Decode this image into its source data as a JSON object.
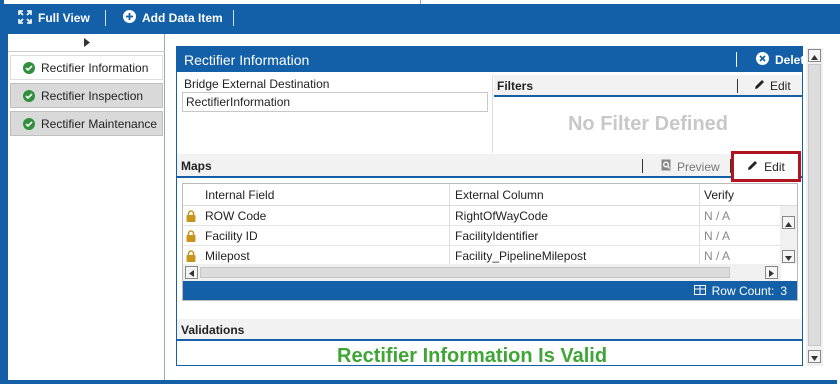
{
  "toolbar": {
    "full_view_label": "Full View",
    "add_data_item_label": "Add Data Item"
  },
  "nav": {
    "items": [
      {
        "label": "Rectifier Information",
        "active": true
      },
      {
        "label": "Rectifier Inspection",
        "active": false
      },
      {
        "label": "Rectifier Maintenance",
        "active": false
      }
    ]
  },
  "panel": {
    "title": "Rectifier Information",
    "delete_label": "Delete",
    "destination_label": "Bridge External Destination",
    "destination_value": "RectifierInformation"
  },
  "filters": {
    "title": "Filters",
    "edit_label": "Edit",
    "empty_text": "No Filter Defined"
  },
  "maps": {
    "title": "Maps",
    "preview_label": "Preview",
    "edit_label": "Edit",
    "columns": [
      "Internal Field",
      "External Column",
      "Verify"
    ],
    "rows": [
      {
        "internal": "ROW Code",
        "external": "RightOfWayCode",
        "verify": "N / A"
      },
      {
        "internal": "Facility ID",
        "external": "FacilityIdentifier",
        "verify": "N / A"
      },
      {
        "internal": "Milepost",
        "external": "Facility_PipelineMilepost",
        "verify": "N / A"
      }
    ],
    "row_count_label": "Row Count:",
    "row_count": "3"
  },
  "validations": {
    "title": "Validations",
    "message": "Rectifier Information Is Valid"
  },
  "colors": {
    "brand": "#1360a8",
    "valid": "#3fa535",
    "highlight": "#b0141e",
    "check": "#2f8f3c",
    "lock": "#c8961e"
  }
}
